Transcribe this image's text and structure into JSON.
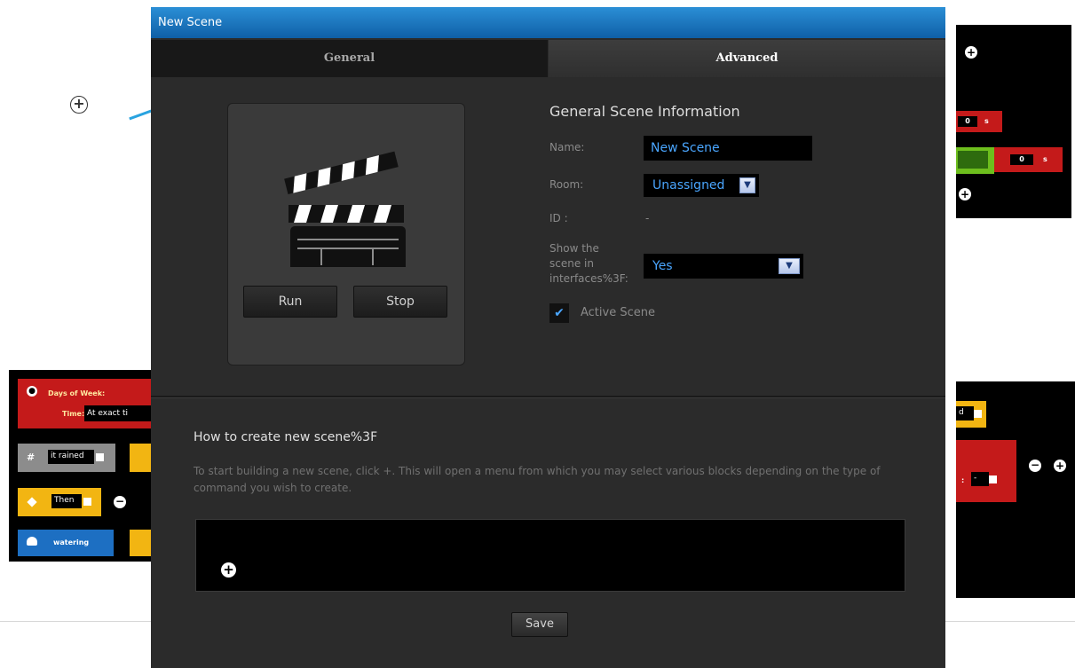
{
  "dialog": {
    "title": "New Scene",
    "tabs": [
      {
        "label": "General",
        "active": false
      },
      {
        "label": "Advanced",
        "active": true
      }
    ]
  },
  "scene_panel": {
    "run_label": "Run",
    "stop_label": "Stop"
  },
  "info": {
    "title": "General Scene Information",
    "name_label": "Name:",
    "name_value": "New Scene",
    "room_label": "Room:",
    "room_value": "Unassigned",
    "id_label": "ID :",
    "id_value": "-",
    "show_label_line1": "Show the",
    "show_label_line2": "scene in",
    "show_label_line3": "interfaces%3F:",
    "show_value": "Yes",
    "active_label": "Active Scene",
    "active_checked": true
  },
  "help": {
    "title": "How to create new scene%3F",
    "text": "To start building a new scene, click +. This will open a menu from which you may select various blocks depending on the type of command you wish to create."
  },
  "canvas": {
    "add_symbol": "+"
  },
  "footer": {
    "save_label": "Save"
  },
  "background": {
    "left_fragment": {
      "days_label": "Days of Week:",
      "time_label": "Time:",
      "time_value": "At exact ti",
      "condition_value": "it rained",
      "then_value": "Then",
      "device_value": "watering"
    },
    "right_fragment_top": {
      "value1": "0",
      "unit1": "s",
      "value2": "0",
      "unit2": "s"
    },
    "right_fragment_bottom": {
      "select_fragment": "d",
      "value": "-"
    }
  },
  "colors": {
    "title_bar": "#1a74bf",
    "dialog_bg": "#2b2b2b",
    "input_text": "#4aa6ff",
    "block_red": "#c41a1a",
    "block_yellow": "#f2b512",
    "block_green": "#6dbe1d",
    "block_blue": "#1d6fc2"
  }
}
